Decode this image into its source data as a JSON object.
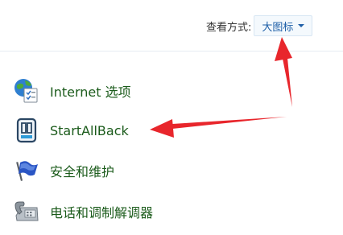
{
  "view_by": {
    "label": "查看方式:",
    "value": "大图标"
  },
  "items": [
    {
      "label": "Internet 选项",
      "icon": "internet-options-icon"
    },
    {
      "label": "StartAllBack",
      "icon": "startallback-icon"
    },
    {
      "label": "安全和维护",
      "icon": "security-maintenance-flag-icon"
    },
    {
      "label": "电话和调制解调器",
      "icon": "phone-modem-icon"
    }
  ],
  "annotation_color": "#e8262c",
  "link_color": "#1b5b1b",
  "accent_color": "#1e5fa8"
}
